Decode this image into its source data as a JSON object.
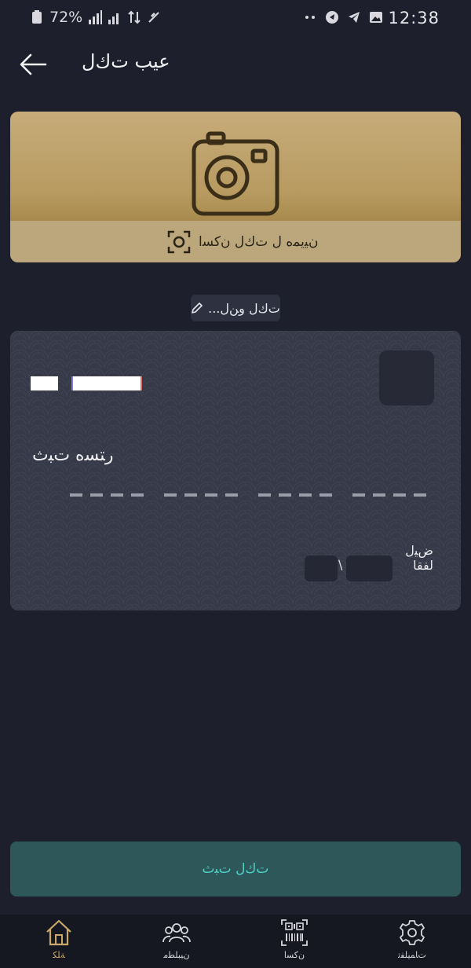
{
  "status_bar": {
    "time": "12:38",
    "battery": "72%"
  },
  "header": {
    "title": "ﻋﻴﺐ ﺕﻙﻝ",
    "back_icon": "arrow-left-icon"
  },
  "photo_card": {
    "scan_label": "ﻥﻴﻳﻤﻩ ﻝ ﺕﻙﻝ ﻥﻛﺴﺍ",
    "camera_icon": "camera-icon",
    "scan_icon": "scan-frame-icon"
  },
  "edit_chip": {
    "label": "...ﺕﻙﻝ ﻭﻦﻝ",
    "icon": "pencil-icon"
  },
  "card": {
    "number_label": "ﺭﺘﺴﻩ ﺕﺒﺙ",
    "expiry_label_line1": "ﺽﻴﻝ",
    "expiry_label_line2": "ﻟﻔﻘﺎ",
    "slash": "\\"
  },
  "submit": {
    "label": "ﺕﻙﻝ ﺕﺒﺙ"
  },
  "bottom_nav": {
    "items": [
      {
        "label": "ﺔﻠﻜ",
        "icon": "home-icon"
      },
      {
        "label": "ﻥﻴﺒﻠﻄﻣ",
        "icon": "users-icon"
      },
      {
        "label": "ﻥﻛﺴﺍ",
        "icon": "qr-barcode-icon"
      },
      {
        "label": "ﺕﺎﻤﻴﻠﻔﺗ",
        "icon": "gear-icon"
      }
    ]
  },
  "colors": {
    "background": "#1d202c",
    "accent_gold": "#c9a86a",
    "submit_bg": "#2d5759",
    "submit_text": "#4fd1c5"
  }
}
